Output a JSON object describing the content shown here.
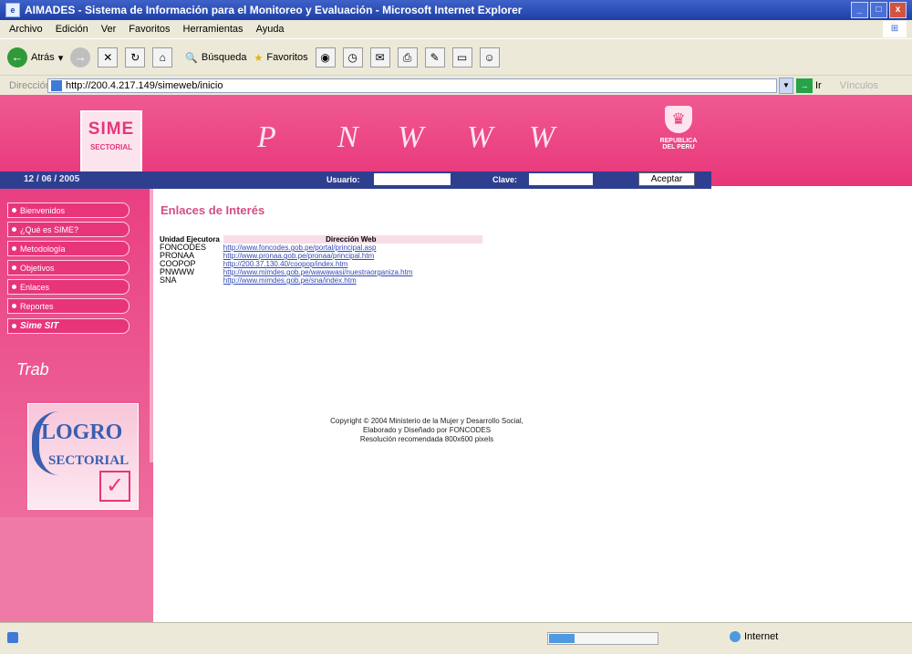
{
  "window": {
    "title": "AIMADES - Sistema de Información para el Monitoreo y Evaluación - Microsoft Internet Explorer",
    "min": "_",
    "max": "□",
    "close": "x"
  },
  "menubar": [
    "Archivo",
    "Edición",
    "Ver",
    "Favoritos",
    "Herramientas",
    "Ayuda"
  ],
  "toolbar": {
    "back": "Atrás",
    "search": "Búsqueda",
    "favorites": "Favoritos"
  },
  "address": {
    "label": "Dirección",
    "url": "http://200.4.217.149/simeweb/inicio",
    "go": "Ir",
    "links": "Vínculos"
  },
  "banner": {
    "logo_top": "SIME",
    "logo_bottom": "SECTORIAL",
    "letters": [
      "P",
      "N",
      "W",
      "W",
      "W"
    ],
    "republica": "REPUBLICA DEL PERU"
  },
  "loginbar": {
    "date": "12 / 06 / 2005",
    "user_label": "Usuario:",
    "pass_label": "Clave:",
    "accept": "Aceptar"
  },
  "sidebar": {
    "items": [
      "Bienvenidos",
      "¿Qué es SIME?",
      "Metodología",
      "Objetivos",
      "Enlaces",
      "Reportes",
      "Sime SIT"
    ],
    "trab": "Trab",
    "logro_top": "LOGRO",
    "logro_bottom": "SECTORIAL"
  },
  "content": {
    "title": "Enlaces de Interés",
    "table": {
      "headers": [
        "Unidad Ejecutora",
        "Dirección Web"
      ],
      "rows": [
        {
          "unit": "FONCODES",
          "url": "http://www.foncodes.gob.pe/portal/principal.asp"
        },
        {
          "unit": "PRONAA",
          "url": "http://www.pronaa.gob.pe/pronaa/principal.htm"
        },
        {
          "unit": "COOPOP",
          "url": "http://200.37.130.40/coopop/index.htm"
        },
        {
          "unit": "PNWWW",
          "url": "http://www.mimdes.gob.pe/wawawasi/nuestraorganiza.htm"
        },
        {
          "unit": "SNA",
          "url": "http://www.mimdes.gob.pe/sna/index.htm"
        }
      ]
    },
    "copyright": [
      "Copyright © 2004 Ministerio de la Mujer y Desarrollo Social,",
      "Elaborado y Diseñado por FONCODES",
      "Resolución recomendada 800x600 pixels"
    ]
  },
  "status": {
    "zone": "Internet"
  }
}
